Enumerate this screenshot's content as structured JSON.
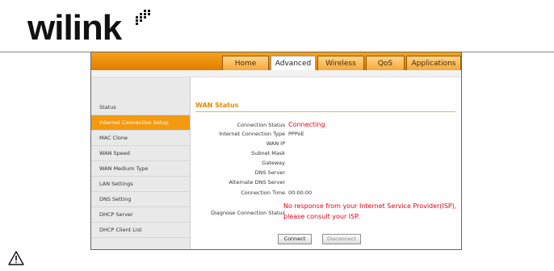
{
  "logo": {
    "text": "wilink"
  },
  "nav": {
    "tabs": [
      {
        "label": "Home",
        "active": false
      },
      {
        "label": "Advanced",
        "active": true
      },
      {
        "label": "Wireless",
        "active": false
      },
      {
        "label": "QoS",
        "active": false
      },
      {
        "label": "Applications",
        "active": false
      }
    ]
  },
  "sidebar": {
    "items": [
      {
        "label": "Status",
        "active": false
      },
      {
        "label": "Internet Connection Setup",
        "active": true
      },
      {
        "label": "MAC Clone",
        "active": false
      },
      {
        "label": "WAN Speed",
        "active": false
      },
      {
        "label": "WAN Medium Type",
        "active": false
      },
      {
        "label": "LAN Settings",
        "active": false
      },
      {
        "label": "DNS Setting",
        "active": false
      },
      {
        "label": "DHCP Server",
        "active": false
      },
      {
        "label": "DHCP Client List",
        "active": false
      }
    ]
  },
  "main": {
    "title": "WAN Status",
    "fields": [
      {
        "label": "Connection Status",
        "value": "Connecting"
      },
      {
        "label": "Internet Connection Type",
        "value": "PPPoE"
      },
      {
        "label": "WAN IP",
        "value": ""
      },
      {
        "label": "Subnet Mask",
        "value": ""
      },
      {
        "label": "Gateway",
        "value": ""
      },
      {
        "label": "DNS Server",
        "value": ""
      },
      {
        "label": "Alternate DNS Server",
        "value": ""
      },
      {
        "label": "Connection Time",
        "value": "00:00:00"
      }
    ],
    "diagnose_label": "Diagnose Connection Status",
    "diagnose_line1": "No response from your Internet Service Provider(ISP),",
    "diagnose_line2": "please consult your ISP.",
    "connect_label": "Connect",
    "disconnect_label": "Disconnect"
  },
  "colors": {
    "accent": "#f39a10",
    "error": "#e3001b",
    "title": "#e98700"
  }
}
